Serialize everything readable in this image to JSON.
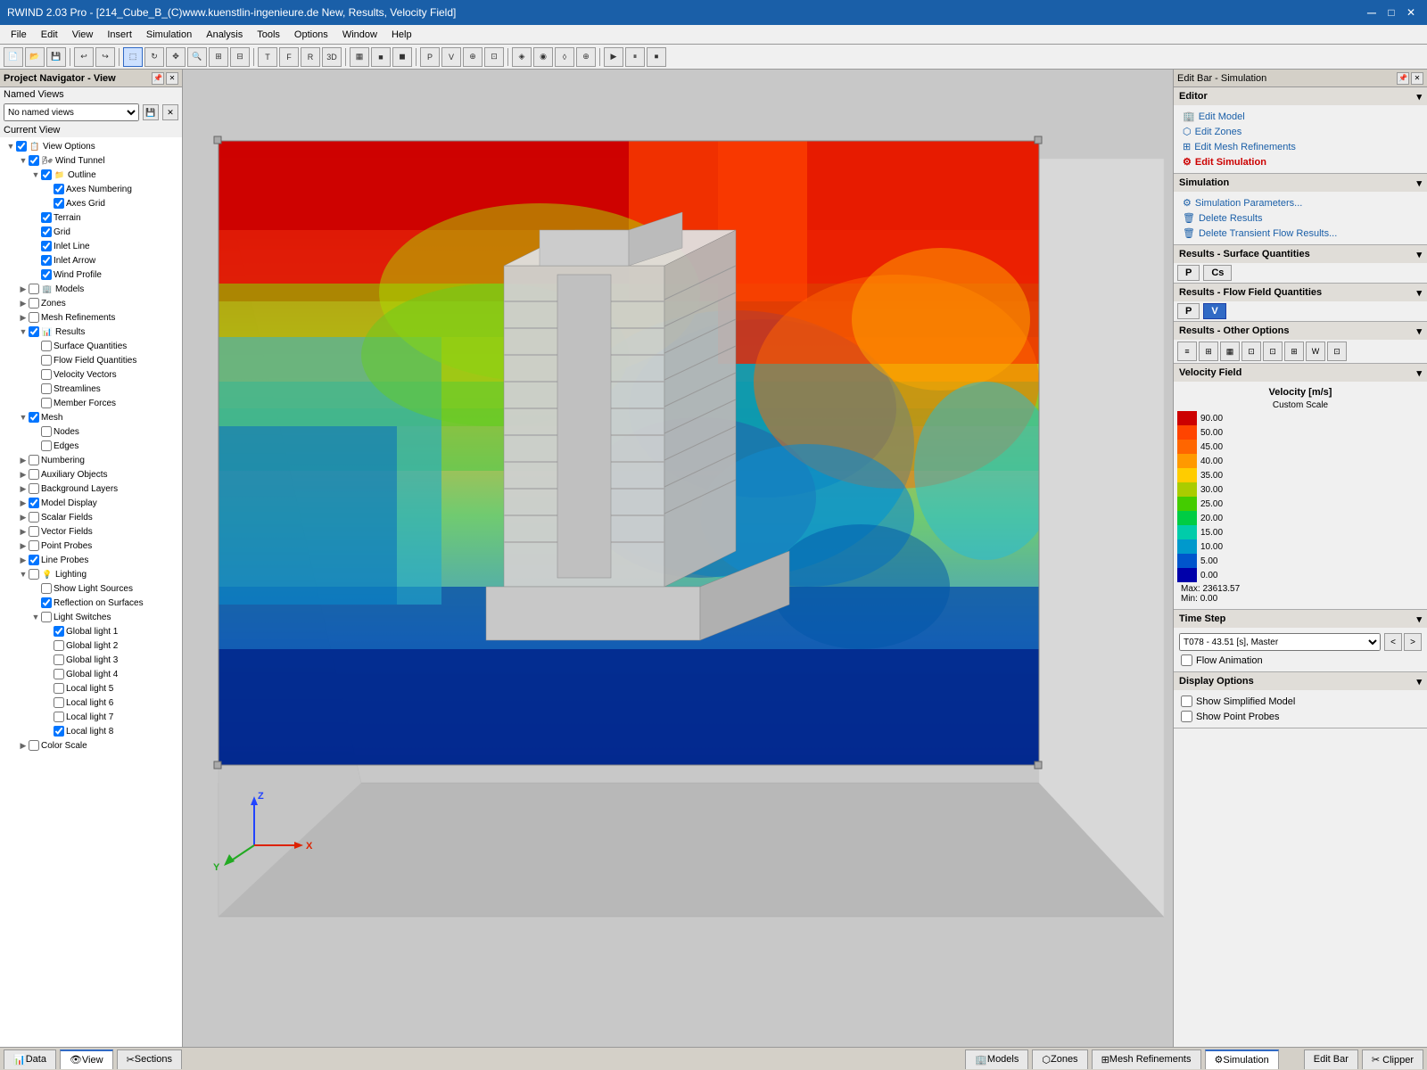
{
  "titlebar": {
    "title": "RWIND 2.03 Pro - [214_Cube_B_(C)www.kuenstlin-ingenieure.de New, Results, Velocity Field]",
    "minimize": "─",
    "restore": "□",
    "close": "✕",
    "min2": "_",
    "max2": "□",
    "close2": "✕"
  },
  "menubar": {
    "items": [
      "File",
      "Edit",
      "View",
      "Insert",
      "Simulation",
      "Analysis",
      "Tools",
      "Options",
      "Window",
      "Help"
    ]
  },
  "leftPanel": {
    "title": "Project Navigator - View",
    "namedViews": {
      "label": "Named Views",
      "placeholder": "No named views"
    },
    "currentView": "Current View",
    "tree": [
      {
        "label": "View Options",
        "indent": 0,
        "expand": true,
        "checked": true,
        "icon": "📋"
      },
      {
        "label": "Wind Tunnel",
        "indent": 1,
        "expand": true,
        "checked": true,
        "icon": "🌬"
      },
      {
        "label": "Outline",
        "indent": 2,
        "expand": true,
        "checked": true,
        "icon": "📁"
      },
      {
        "label": "Axes Numbering",
        "indent": 3,
        "checked": true,
        "icon": ""
      },
      {
        "label": "Axes Grid",
        "indent": 3,
        "checked": true,
        "icon": ""
      },
      {
        "label": "Terrain",
        "indent": 2,
        "checked": true,
        "icon": ""
      },
      {
        "label": "Grid",
        "indent": 2,
        "checked": true,
        "icon": ""
      },
      {
        "label": "Inlet Line",
        "indent": 2,
        "checked": true,
        "icon": ""
      },
      {
        "label": "Inlet Arrow",
        "indent": 2,
        "checked": true,
        "icon": ""
      },
      {
        "label": "Wind Profile",
        "indent": 2,
        "checked": true,
        "icon": ""
      },
      {
        "label": "Models",
        "indent": 1,
        "expand": false,
        "checked": false,
        "icon": "🏢"
      },
      {
        "label": "Zones",
        "indent": 1,
        "expand": false,
        "checked": false,
        "icon": ""
      },
      {
        "label": "Mesh Refinements",
        "indent": 1,
        "expand": false,
        "checked": false,
        "icon": ""
      },
      {
        "label": "Results",
        "indent": 1,
        "expand": true,
        "checked": true,
        "icon": "📊"
      },
      {
        "label": "Surface Quantities",
        "indent": 2,
        "checked": false,
        "icon": ""
      },
      {
        "label": "Flow Field Quantities",
        "indent": 2,
        "checked": false,
        "icon": ""
      },
      {
        "label": "Velocity Vectors",
        "indent": 2,
        "checked": false,
        "icon": ""
      },
      {
        "label": "Streamlines",
        "indent": 2,
        "checked": false,
        "icon": ""
      },
      {
        "label": "Member Forces",
        "indent": 2,
        "checked": false,
        "icon": ""
      },
      {
        "label": "Mesh",
        "indent": 1,
        "expand": true,
        "checked": true,
        "icon": ""
      },
      {
        "label": "Nodes",
        "indent": 2,
        "checked": false,
        "icon": ""
      },
      {
        "label": "Edges",
        "indent": 2,
        "checked": false,
        "icon": ""
      },
      {
        "label": "Numbering",
        "indent": 1,
        "expand": false,
        "checked": false,
        "icon": ""
      },
      {
        "label": "Auxiliary Objects",
        "indent": 1,
        "expand": false,
        "checked": false,
        "icon": ""
      },
      {
        "label": "Background Layers",
        "indent": 1,
        "expand": false,
        "checked": false,
        "icon": ""
      },
      {
        "label": "Model Display",
        "indent": 1,
        "expand": false,
        "checked": true,
        "icon": ""
      },
      {
        "label": "Scalar Fields",
        "indent": 1,
        "expand": false,
        "checked": false,
        "icon": ""
      },
      {
        "label": "Vector Fields",
        "indent": 1,
        "expand": false,
        "checked": false,
        "icon": ""
      },
      {
        "label": "Point Probes",
        "indent": 1,
        "expand": false,
        "checked": false,
        "icon": ""
      },
      {
        "label": "Line Probes",
        "indent": 1,
        "expand": false,
        "checked": true,
        "icon": ""
      },
      {
        "label": "Lighting",
        "indent": 1,
        "expand": true,
        "checked": false,
        "icon": "💡"
      },
      {
        "label": "Show Light Sources",
        "indent": 2,
        "checked": false,
        "icon": ""
      },
      {
        "label": "Reflection on Surfaces",
        "indent": 2,
        "checked": true,
        "icon": ""
      },
      {
        "label": "Light Switches",
        "indent": 2,
        "expand": true,
        "checked": false,
        "icon": ""
      },
      {
        "label": "Global light 1",
        "indent": 3,
        "checked": true,
        "icon": ""
      },
      {
        "label": "Global light 2",
        "indent": 3,
        "checked": false,
        "icon": ""
      },
      {
        "label": "Global light 3",
        "indent": 3,
        "checked": false,
        "icon": ""
      },
      {
        "label": "Global light 4",
        "indent": 3,
        "checked": false,
        "icon": ""
      },
      {
        "label": "Local light 5",
        "indent": 3,
        "checked": false,
        "icon": ""
      },
      {
        "label": "Local light 6",
        "indent": 3,
        "checked": false,
        "icon": ""
      },
      {
        "label": "Local light 7",
        "indent": 3,
        "checked": false,
        "icon": ""
      },
      {
        "label": "Local light 8",
        "indent": 3,
        "checked": true,
        "icon": ""
      },
      {
        "label": "Color Scale",
        "indent": 1,
        "expand": false,
        "checked": false,
        "icon": ""
      }
    ]
  },
  "rightPanel": {
    "title": "Edit Bar - Simulation",
    "editor": {
      "label": "Editor",
      "editModel": "Edit Model",
      "editZones": "Edit Zones",
      "editMeshRefinements": "Edit Mesh Refinements",
      "editSimulation": "Edit Simulation"
    },
    "simulation": {
      "title": "Simulation",
      "simParams": "Simulation Parameters...",
      "deleteResults": "Delete Results",
      "deleteTransient": "Delete Transient Flow Results..."
    },
    "surfaceQuantities": {
      "title": "Results - Surface Quantities",
      "btn1": "P",
      "btn2": "Cs"
    },
    "flowField": {
      "title": "Results - Flow Field Quantities",
      "btn1": "P",
      "btn2": "V"
    },
    "otherOptions": {
      "title": "Results - Other Options",
      "buttons": [
        "≡≡",
        "⊞",
        "▦",
        "⊡",
        "⊡",
        "⊞",
        "W",
        "⊡"
      ]
    },
    "velocityField": {
      "title": "Velocity Field",
      "subtitle1": "Velocity [m/s]",
      "subtitle2": "Custom Scale",
      "scale": [
        {
          "value": "90.00",
          "color": "#cc0000"
        },
        {
          "value": "50.00",
          "color": "#ff4400"
        },
        {
          "value": "45.00",
          "color": "#ff6600"
        },
        {
          "value": "40.00",
          "color": "#ff9900"
        },
        {
          "value": "35.00",
          "color": "#ffcc00"
        },
        {
          "value": "30.00",
          "color": "#aacc00"
        },
        {
          "value": "25.00",
          "color": "#44cc00"
        },
        {
          "value": "20.00",
          "color": "#00cc44"
        },
        {
          "value": "15.00",
          "color": "#00ccaa"
        },
        {
          "value": "10.00",
          "color": "#0099cc"
        },
        {
          "value": "5.00",
          "color": "#0055cc"
        },
        {
          "value": "0.00",
          "color": "#0000aa"
        }
      ],
      "maxLabel": "Max:",
      "maxVal": "23613.57",
      "minLabel": "Min:",
      "minVal": "0.00"
    },
    "timeStep": {
      "title": "Time Step",
      "value": "T078 - 43.51 [s], Master",
      "prevBtn": "<",
      "nextBtn": ">"
    },
    "flowAnimation": {
      "label": "Flow Animation",
      "checked": false
    },
    "displayOptions": {
      "title": "Display Options",
      "showSimplified": "Show Simplified Model",
      "showPointProbes": "Show Point Probes",
      "simplifiedChecked": false,
      "pointProbesChecked": false
    }
  },
  "statusBar": {
    "leftTabs": [
      "Data",
      "View",
      "Sections"
    ],
    "activeLeftTab": "View",
    "rightTabs": [
      "Models",
      "Zones",
      "Mesh Refinements",
      "Simulation"
    ],
    "rightTabActive": "Simulation",
    "editBar": "Edit Bar",
    "clipper": "Clipper"
  },
  "viewport": {
    "bgColor": "#c0c0c0"
  }
}
